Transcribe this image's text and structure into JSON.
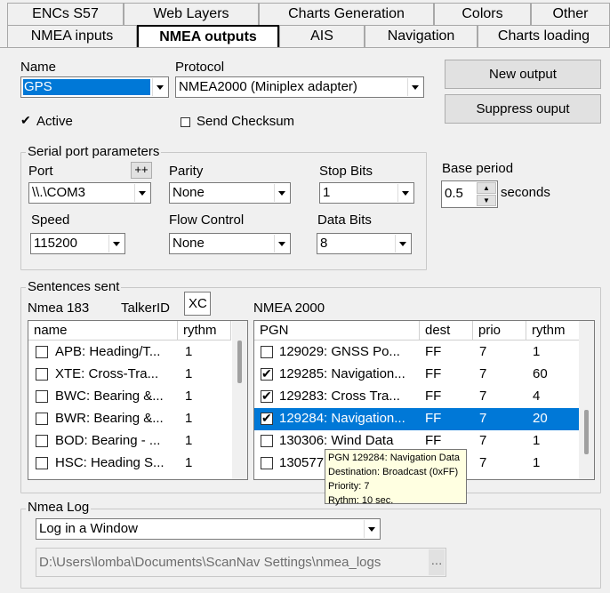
{
  "tabs_row1": [
    "ENCs S57",
    "Web Layers",
    "Charts Generation",
    "Colors",
    "Other"
  ],
  "tabs_row2": [
    "NMEA inputs",
    "NMEA outputs",
    "AIS",
    "Navigation",
    "Charts loading"
  ],
  "name": {
    "label": "Name",
    "value": "GPS"
  },
  "protocol": {
    "label": "Protocol",
    "value": "NMEA2000 (Miniplex adapter)"
  },
  "buttons": {
    "new_output": "New output",
    "suppress_output": "Suppress ouput"
  },
  "active": {
    "label": "Active",
    "checked": true
  },
  "send_checksum": {
    "label": "Send Checksum",
    "checked": false
  },
  "serial": {
    "legend": "Serial port parameters",
    "port_label": "Port",
    "port_add": "++",
    "port_value": "\\\\.\\COM3",
    "parity_label": "Parity",
    "parity_value": "None",
    "stopbits_label": "Stop Bits",
    "stopbits_value": "1",
    "speed_label": "Speed",
    "speed_value": "115200",
    "flow_label": "Flow Control",
    "flow_value": "None",
    "databits_label": "Data Bits",
    "databits_value": "8"
  },
  "base_period": {
    "label": "Base period",
    "value": "0.5",
    "unit": "seconds"
  },
  "sentences": {
    "legend": "Sentences sent",
    "nmea183_label": "Nmea 183",
    "talker_label": "TalkerID",
    "talker_value": "XC",
    "nmea2000_label": "NMEA 2000",
    "n183_headers": [
      "name",
      "rythm"
    ],
    "n183_rows": [
      {
        "name": "APB: Heading/T...",
        "rythm": "1",
        "checked": false
      },
      {
        "name": "XTE: Cross-Tra...",
        "rythm": "1",
        "checked": false
      },
      {
        "name": "BWC: Bearing &...",
        "rythm": "1",
        "checked": false
      },
      {
        "name": "BWR: Bearing &...",
        "rythm": "1",
        "checked": false
      },
      {
        "name": "BOD: Bearing - ...",
        "rythm": "1",
        "checked": false
      },
      {
        "name": "HSC: Heading S...",
        "rythm": "1",
        "checked": false
      }
    ],
    "n2k_headers": [
      "PGN",
      "dest",
      "prio",
      "rythm"
    ],
    "n2k_rows": [
      {
        "pgn": "129029: GNSS Po...",
        "dest": "FF",
        "prio": "7",
        "rythm": "1",
        "checked": false
      },
      {
        "pgn": "129285: Navigation...",
        "dest": "FF",
        "prio": "7",
        "rythm": "60",
        "checked": true
      },
      {
        "pgn": "129283: Cross Tra...",
        "dest": "FF",
        "prio": "7",
        "rythm": "4",
        "checked": true
      },
      {
        "pgn": "129284: Navigation...",
        "dest": "FF",
        "prio": "7",
        "rythm": "20",
        "checked": true
      },
      {
        "pgn": "130306: Wind Data",
        "dest": "FF",
        "prio": "7",
        "rythm": "1",
        "checked": false
      },
      {
        "pgn": "130577",
        "dest": "",
        "prio": "7",
        "rythm": "1",
        "checked": false
      }
    ]
  },
  "tooltip": {
    "line1": "PGN 129284: Navigation Data",
    "line2": "Destination: Broadcast (0xFF)",
    "line3": "Priority: 7",
    "line4": "Rythm: 10 sec."
  },
  "nmea_log": {
    "legend": "Nmea Log",
    "mode_value": "Log in a Window",
    "path_value": "D:\\Users\\lomba\\Documents\\ScanNav Settings\\nmea_logs",
    "browse": "..."
  },
  "colors": {
    "selection": "#0078d7",
    "tooltip_bg": "#ffffe1"
  }
}
